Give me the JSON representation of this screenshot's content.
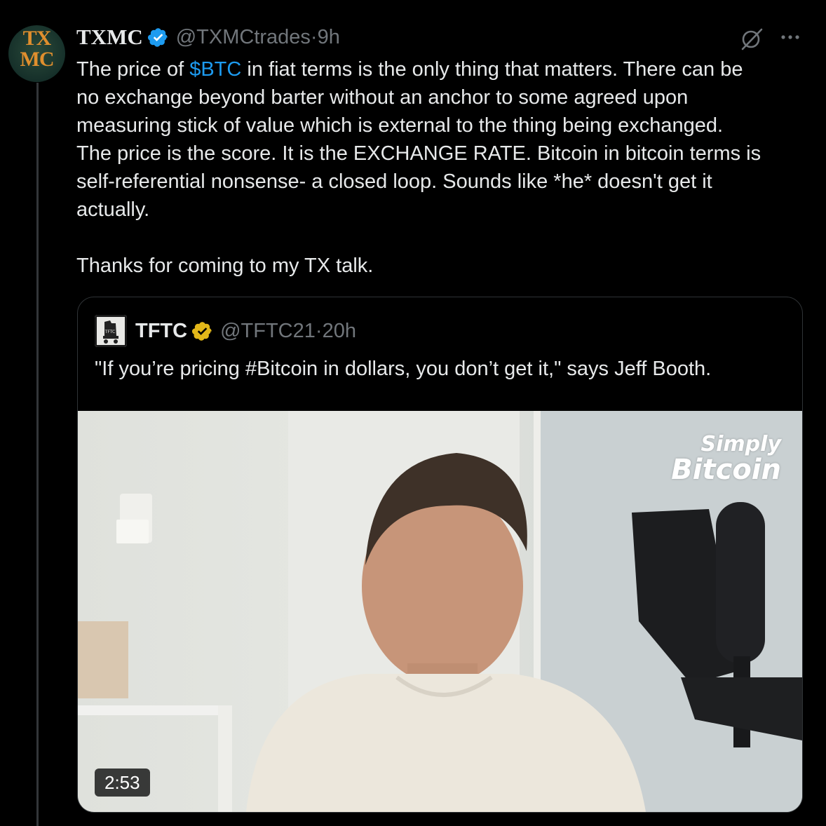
{
  "tweet": {
    "avatar_text_top": "TX",
    "avatar_text_bottom": "MC",
    "display_name": "TXMC",
    "handle": "@TXMCtrades",
    "separator": " · ",
    "time": "9h",
    "text_before_cashtag": "The price of ",
    "cashtag": "$BTC",
    "text_after_cashtag": " in fiat terms is the only thing that matters. There can be\nno exchange beyond barter without an anchor to some agreed upon\nmeasuring stick of value which is external to the thing being exchanged.\nThe price is the score. It is the EXCHANGE RATE. Bitcoin in bitcoin terms is\nself-referential nonsense- a closed loop. Sounds like *he* doesn't get it\nactually.\n\nThanks for coming to my TX talk.",
    "icons": [
      "verified-badge-icon",
      "grok-icon",
      "more-options-icon"
    ]
  },
  "quote": {
    "display_name": "TFTC",
    "handle": "@TFTC21",
    "separator": " · ",
    "time": "20h",
    "text": "\"If you’re pricing #Bitcoin in dollars, you don’t get it,\" says Jeff Booth.",
    "video": {
      "duration": "2:53",
      "watermark_line1": "Simply",
      "watermark_line2": "Bitcoin"
    }
  },
  "colors": {
    "background": "#000000",
    "text": "#e7e9ea",
    "secondary": "#71767b",
    "link": "#1d9bf0",
    "verified_blue": "#1d9bf0",
    "verified_gold": "#e2b719",
    "border": "#2f3336"
  }
}
